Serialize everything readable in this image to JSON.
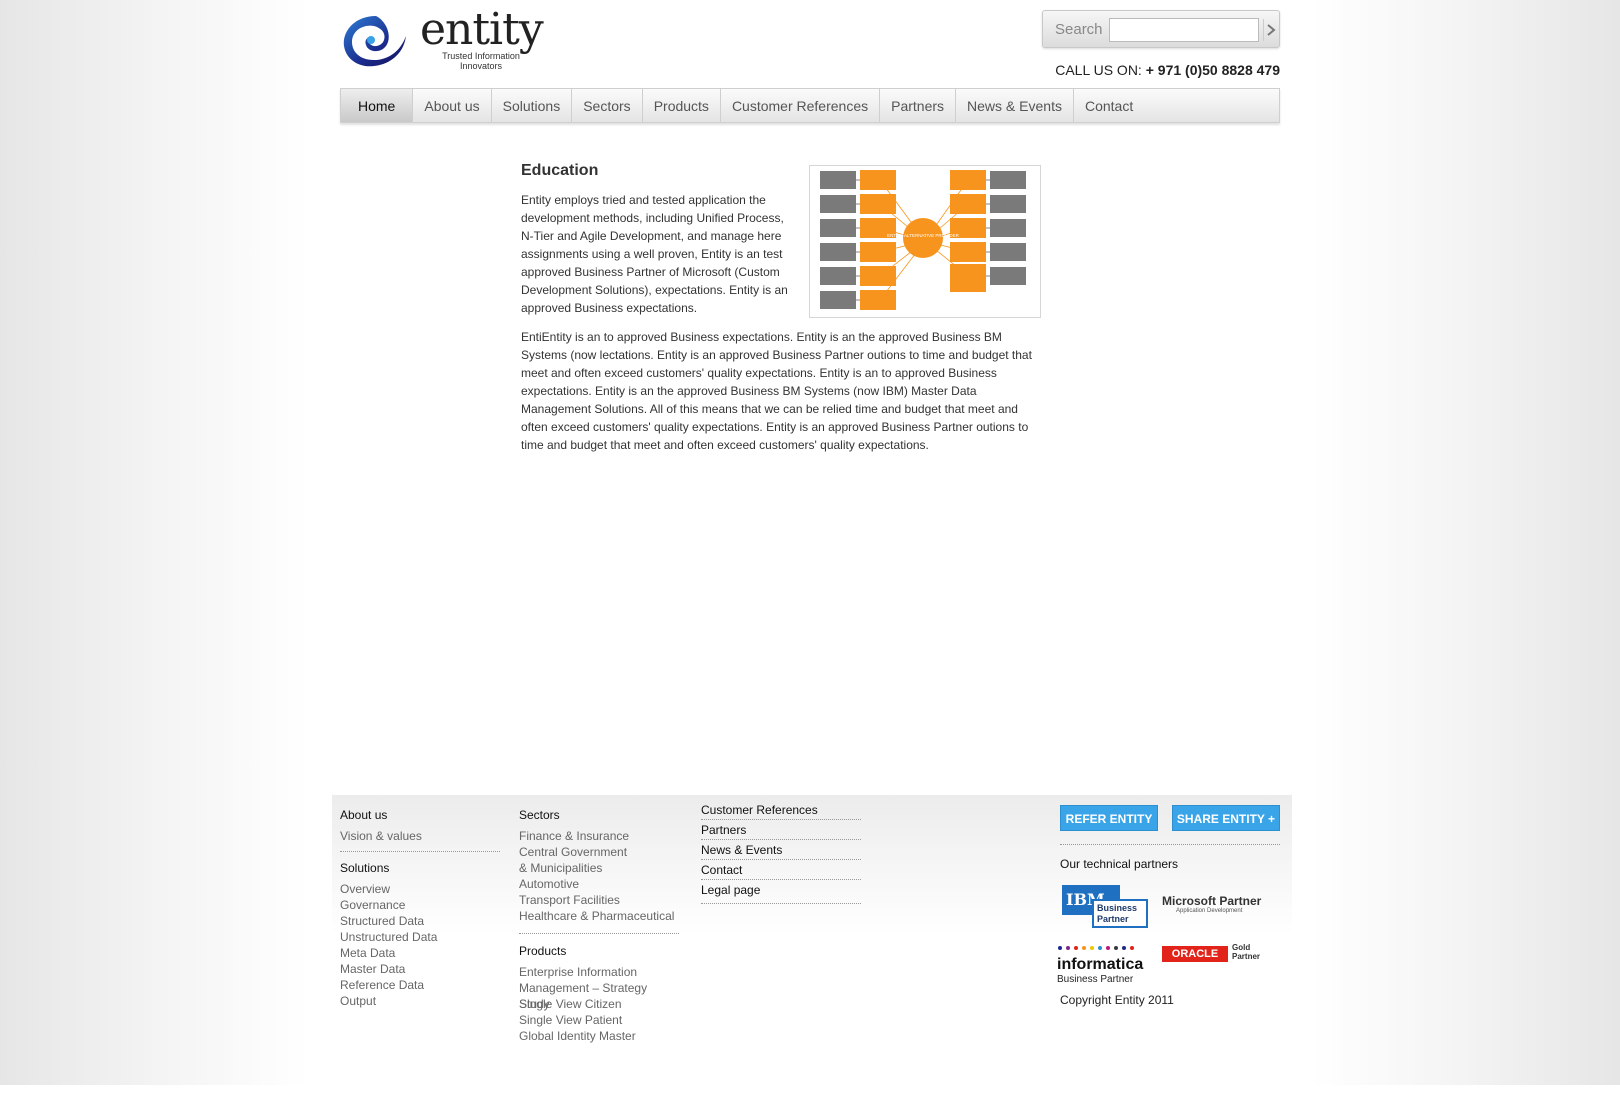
{
  "header": {
    "logo_word": "entity",
    "logo_tag_line1": "Trusted Information",
    "logo_tag_line2": "Innovators",
    "search_label": "Search",
    "search_value": "",
    "call_label": "CALL US ON:",
    "call_number": "+ 971 (0)50 8828 479"
  },
  "nav": {
    "items": [
      "Home",
      "About us",
      "Solutions",
      "Sectors",
      "Products",
      "Customer References",
      "Partners",
      "News & Events",
      "Contact"
    ],
    "active": "Home"
  },
  "content": {
    "title": "Education",
    "para1": "Entity employs tried and tested application the development methods, including Unified Process, N-Tier and Agile Development, and manage here assignments using a well proven, Entity is an  test approved Business Partner of Microsoft (Custom Development Solutions), expectations. Entity is an approved Business expectations.",
    "para2": "EntiEntity is an to  approved Business expectations. Entity is an the  approved Business BM Systems (now lectations. Entity is an  approved Business Partner outions to time and budget that meet and often exceed customers' quality expectations. Entity is an to  approved Business expectations. Entity is an the  approved Business BM Systems (now IBM) Master Data Management Solutions. All of this means that we can be relied time and budget that meet and often exceed customers' quality expectations. Entity is an  approved Business Partner outions to time and budget that meet and often exceed customers' quality expectations.",
    "diagram_center": "ENTITY ALTERNATIVE PROVIDER"
  },
  "footer": {
    "col1": {
      "about_head": "About us",
      "about_links": [
        "Vision & values"
      ],
      "solutions_head": "Solutions",
      "solutions_links": [
        "Overview",
        "Governance",
        "Structured Data",
        "Unstructured Data",
        "Meta Data",
        "Master Data",
        "Reference Data",
        "Output"
      ]
    },
    "col2": {
      "sectors_head": "Sectors",
      "sectors_links": [
        "Finance & Insurance",
        "Central Government",
        "& Municipalities",
        "Automotive",
        "Transport Facilities",
        "Healthcare & Pharmaceutical"
      ],
      "products_head": "Products",
      "products_links": [
        "Enterprise Information",
        "Management – Strategy Study",
        "Single View Citizen",
        "Single View Patient",
        "Global Identity Master"
      ]
    },
    "col3": {
      "links": [
        "Customer References",
        "Partners",
        "News & Events",
        "Contact",
        "Legal page"
      ]
    },
    "refer_label": "REFER ENTITY",
    "share_label": "SHARE ENTITY +",
    "partners_head": "Our technical partners",
    "ibm_text": "IBM",
    "ibm_bp_line1": "Business",
    "ibm_bp_line2": "Partner",
    "ms_partner": "Microsoft Partner",
    "ms_sub": "Application Development",
    "informatica": "Informatica",
    "informatica_sub": "Business Partner",
    "oracle": "ORACLE",
    "oracle_gold_1": "Gold",
    "oracle_gold_2": "Partner",
    "copyright": "Copyright Entity 2011"
  },
  "colors": {
    "accent_orange": "#f7941d",
    "button_blue": "#3aa4e8",
    "ibm_blue": "#1f70c1",
    "oracle_red": "#e2231a",
    "logo_blue": "#1b2a8c"
  }
}
